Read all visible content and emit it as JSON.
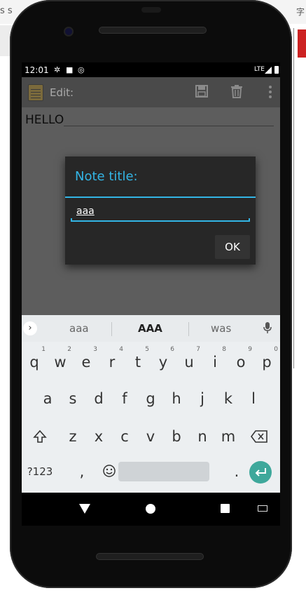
{
  "background": {
    "top_left_text": "s s",
    "top_right_text": "字"
  },
  "status_bar": {
    "time": "12:01",
    "network": "LTE",
    "icons": [
      "settings-icon",
      "sd-card-icon",
      "data-saver-icon",
      "signal-icon",
      "battery-icon"
    ]
  },
  "action_bar": {
    "title": "Edit:",
    "icons": [
      "notepad-icon",
      "save-icon",
      "delete-icon",
      "overflow-menu-icon"
    ]
  },
  "editor": {
    "text": "HELLO"
  },
  "dialog": {
    "title": "Note title:",
    "input_value": "aaa",
    "ok_label": "OK",
    "accent": "#33b5e5"
  },
  "keyboard": {
    "suggestions": [
      "aaa",
      "AAA",
      "was"
    ],
    "row1": [
      {
        "key": "q",
        "num": "1"
      },
      {
        "key": "w",
        "num": "2"
      },
      {
        "key": "e",
        "num": "3"
      },
      {
        "key": "r",
        "num": "4"
      },
      {
        "key": "t",
        "num": "5"
      },
      {
        "key": "y",
        "num": "6"
      },
      {
        "key": "u",
        "num": "7"
      },
      {
        "key": "i",
        "num": "8"
      },
      {
        "key": "o",
        "num": "9"
      },
      {
        "key": "p",
        "num": "0"
      }
    ],
    "row2": [
      "a",
      "s",
      "d",
      "f",
      "g",
      "h",
      "j",
      "k",
      "l"
    ],
    "row3": [
      "z",
      "x",
      "c",
      "v",
      "b",
      "n",
      "m"
    ],
    "symbols_label": "?123",
    "comma": ",",
    "period": ".",
    "enter_color": "#3ea89b"
  }
}
